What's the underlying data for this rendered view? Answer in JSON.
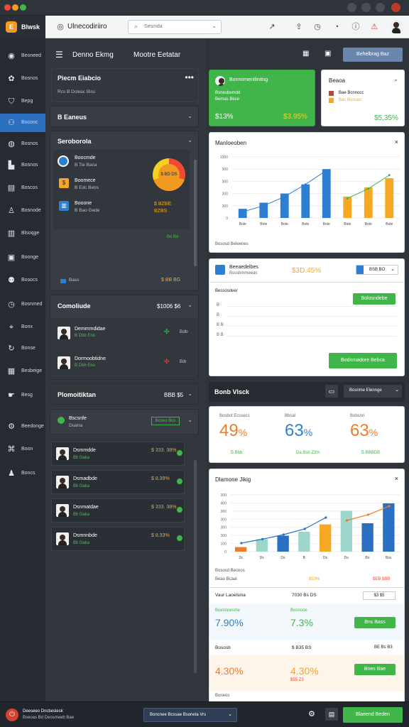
{
  "window": {
    "tab_icons": [
      "#ef4a36",
      "#f29a1f",
      "#3fb54a"
    ]
  },
  "brand": {
    "logo_letter": "E",
    "name": "Blwsk"
  },
  "topbar": {
    "app_title": "Ulnecodiriiro",
    "search_placeholder": "Sesmda"
  },
  "sidebar": {
    "items": [
      {
        "label": "Beoneed",
        "icon": "user-avatar-icon",
        "active": false
      },
      {
        "label": "Bosnos",
        "icon": "gear-icon",
        "active": false
      },
      {
        "label": "Bepg",
        "icon": "shield-icon",
        "active": false
      },
      {
        "label": "Boconc",
        "icon": "users-icon",
        "active": true
      },
      {
        "label": "Bosnos",
        "icon": "globe-icon",
        "active": false
      },
      {
        "label": "Bosnos",
        "icon": "chart-icon",
        "active": false
      },
      {
        "label": "Boscos",
        "icon": "document-icon",
        "active": false
      },
      {
        "label": "Bosnode",
        "icon": "user-icon",
        "active": false
      },
      {
        "label": "Blsoqge",
        "icon": "book-icon",
        "active": false
      },
      {
        "label": "Boonge",
        "icon": "image-icon",
        "active": false
      },
      {
        "label": "Bosocs",
        "icon": "people-icon",
        "active": false
      },
      {
        "label": "Bosnmed",
        "icon": "clock-icon",
        "active": false
      },
      {
        "label": "Bonx",
        "icon": "tag-icon",
        "active": false
      },
      {
        "label": "Bonse",
        "icon": "refresh-icon",
        "active": false
      },
      {
        "label": "Besbeige",
        "icon": "building-icon",
        "active": false
      },
      {
        "label": "Besg",
        "icon": "hand-icon",
        "active": false
      },
      {
        "label": "Beedonge",
        "icon": "settings-icon",
        "active": false
      },
      {
        "label": "Boon",
        "icon": "network-icon",
        "active": false
      },
      {
        "label": "Boncs",
        "icon": "person-icon",
        "active": false
      }
    ]
  },
  "subheader": {
    "title": "Denno Ekmg",
    "subtitle": "Mootre Eetatar",
    "action_label": "Behelbrag Baz"
  },
  "mid": {
    "header": {
      "title": "Piecm Eiabcio",
      "subtitle": "Rcs B Dcleac Biss"
    },
    "section1": {
      "title": "B Eaneus"
    },
    "section2": {
      "title": "Seroborola",
      "rows": [
        {
          "title": "Boocmde",
          "sub": "B Tie Baca",
          "value": ""
        },
        {
          "title": "Boomece",
          "sub": "B Edc Bebs",
          "value": ""
        },
        {
          "title": "Booone",
          "sub": "B Bao Gede",
          "value": "$ BZBE BZBS"
        }
      ],
      "ring_label": "$ BD DS",
      "extra": "Bo Bo",
      "footer_label": "Bass",
      "footer_value": "$ BB BG"
    },
    "section3": {
      "title": "Comoliude",
      "value": "$1006 $6",
      "rows": [
        {
          "title": "Demmmdidae",
          "sub": "B Dbb Eno",
          "value": "Bdb"
        },
        {
          "title": "Dormoobtidne",
          "sub": "B Dbb Eno",
          "value": "Bib"
        }
      ]
    },
    "section4": {
      "title": "Plomoitiktan",
      "value": "BBB $5",
      "subtitle": "Bscsnfe",
      "sub2": "Duana",
      "badge": "Bcoeo Bcs"
    },
    "people": [
      {
        "name": "Dsmmdde",
        "sub": "Bb Daka",
        "value": "$ 333. 38%"
      },
      {
        "name": "Dsmadbde",
        "sub": "Bb Daka",
        "value": "$ 8.39%"
      },
      {
        "name": "Dsnmatdae",
        "sub": "Bb Daka",
        "value": "$ 333. 38%"
      },
      {
        "name": "Dsmnnbde",
        "sub": "Bb Daka",
        "value": "$ 8.33%"
      }
    ]
  },
  "right": {
    "card_green": {
      "title": "Bonnomentlinitng",
      "sub1": "Bsneubemdd",
      "sub2": "Bemas Bece",
      "value_left": "$13%",
      "value_right": "$3.95%"
    },
    "card_white": {
      "title": "Beaoa",
      "sub1": "Bae Bcnnocc",
      "sub2": "Bac Bosoas",
      "value": "$5,35%"
    },
    "chart1": {
      "title": "Manloeoben",
      "footer": "Bososd Beleenes"
    },
    "card_table": {
      "title": "Beeaedelbes",
      "sub": "Bsssbmmeeas",
      "value": "$3D.45%",
      "ctrl": "BSB BO",
      "button": "Bolosndebe",
      "list_title": "Bessosdeer",
      "ticks": [
        "B",
        "B",
        "B B",
        "B B"
      ],
      "submit": "Bodnmadore Bebca"
    },
    "section_dark": {
      "title": "Bonb Vlsck",
      "select": "Bosnme Elennge"
    },
    "stats": [
      {
        "label": "Bosbot Ecssecs",
        "big": "49",
        "unit": "%",
        "foot": "B Bbb",
        "color": "#f07c2a"
      },
      {
        "label": "Bbsal",
        "big": "63",
        "unit": "%",
        "foot": "Da Bsb Z3%",
        "color": "#2d82c8"
      },
      {
        "label": "Bobsnn",
        "big": "63",
        "unit": "%",
        "foot": "B BBBDB",
        "color": "#f07c2a"
      }
    ],
    "chart2": {
      "title": "Dlamone Jikig",
      "footer": "Bososd Beceos",
      "footer_left": "Beao Bcaal",
      "footer_mid": "$53%",
      "footer_right": "$EB $BB"
    },
    "row1": {
      "title": "Vaur Laoelsina",
      "value": "7030 Bs DS",
      "ctrl": "$3 $5"
    },
    "pct1": {
      "title": "Boesnnesme",
      "left": "7.90%",
      "mid": "7.3%",
      "mid_label": "Bosnooe",
      "button": "Bns Bass"
    },
    "row2": {
      "title": "Bososb",
      "value": "$ B35 BS",
      "ctrl": "BE Bs B3"
    },
    "pct2": {
      "left": "4.30%",
      "mid": "4.30%",
      "mid_sub": "$55 Z3",
      "button": "Bnes Bae"
    },
    "footer_label": "Boneos"
  },
  "bottom": {
    "brand_line1": "Deeseeo Dncbeslesk",
    "brand_line2": "Bseoas Bd Deosmeeb Bae",
    "select": "Boncnee Bcssae Bsoneta Vrs",
    "cta": "Blaeend Beden"
  },
  "chart_data": [
    {
      "type": "bar",
      "categories": [
        "Bole",
        "Bole",
        "Bole",
        "Bole",
        "Bole",
        "Bole",
        "Bole",
        "Bole"
      ],
      "yticks": [
        "0",
        "300",
        "300",
        "300",
        "300",
        "1000"
      ],
      "series": [
        {
          "values": [
            15,
            25,
            40,
            55,
            80,
            35,
            50,
            65
          ]
        },
        {
          "values": [
            10,
            20,
            30,
            45,
            60,
            28,
            45,
            60
          ]
        }
      ],
      "line": [
        10,
        20,
        35,
        55,
        78,
        32,
        48,
        70
      ],
      "colors": [
        "#2d7fd1",
        "#f6a823"
      ]
    },
    {
      "type": "bar",
      "categories": [
        "2s",
        "Ds",
        "Ds",
        "B",
        "Ds",
        "Ds",
        "Bo",
        "Bss"
      ],
      "yticks": [
        "0",
        "100",
        "300",
        "300",
        "300",
        "300",
        "400",
        "300"
      ],
      "values": [
        8,
        22,
        28,
        35,
        48,
        72,
        50,
        85
      ],
      "colors": [
        "#f07c2a",
        "#9fd6cb",
        "#2a6fc2",
        "#9fd6cb",
        "#f6a823",
        "#9fd6cb",
        "#2a6fc2",
        "#2a6fc2"
      ],
      "line1": [
        15,
        22,
        30,
        40,
        60
      ],
      "line2": [
        55,
        65,
        80
      ]
    }
  ]
}
